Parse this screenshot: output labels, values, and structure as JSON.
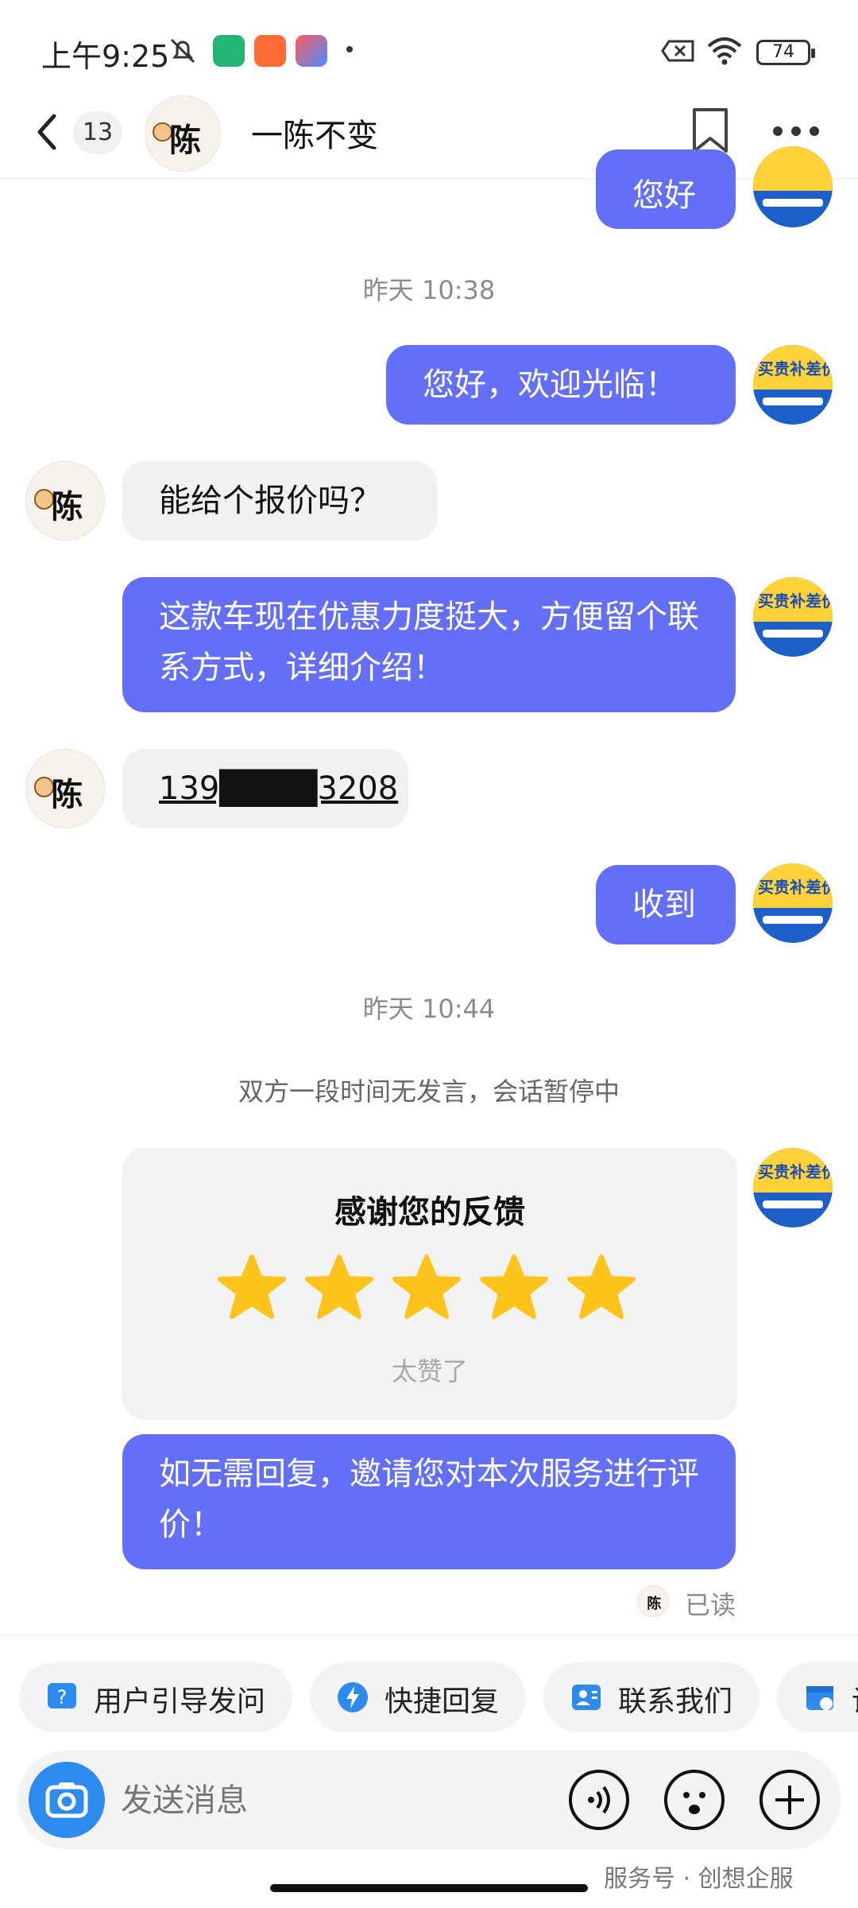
{
  "status_bar": {
    "time": "上午9:25",
    "battery": "74"
  },
  "header": {
    "unread_count": "13",
    "contact_name": "一陈不变",
    "contact_avatar_char": "陈"
  },
  "brand_avatar": {
    "text": "买贵补差价"
  },
  "messages": [
    {
      "side": "out",
      "text": "您好"
    },
    {
      "type": "timestamp",
      "text": "昨天 10:38"
    },
    {
      "side": "out",
      "text": "您好，欢迎光临！"
    },
    {
      "side": "in",
      "text": "能给个报价吗？"
    },
    {
      "side": "out",
      "text": "这款车现在优惠力度挺大，方便留个联系方式，详细介绍！"
    },
    {
      "side": "in",
      "text": "139████3208"
    },
    {
      "side": "out",
      "text": "收到"
    },
    {
      "type": "timestamp",
      "text": "昨天 10:44"
    },
    {
      "type": "system",
      "text": "双方一段时间无发言，会话暂停中"
    },
    {
      "side": "out",
      "text": "如无需回复，邀请您对本次服务进行评价！"
    }
  ],
  "rating_card": {
    "title": "感谢您的反馈",
    "rating": 5,
    "max": 5,
    "caption": "太赞了",
    "star_color": "#ffc41c"
  },
  "read_receipt": "已读",
  "quick_replies": [
    "用户引导发问",
    "快捷回复",
    "联系我们",
    "设"
  ],
  "input": {
    "placeholder": "发送消息"
  },
  "watermark": "服务号 · 创想企服",
  "colors": {
    "outgoing_bubble": "#636ff6",
    "incoming_bubble": "#f1f1f1",
    "accent_blue": "#2d8bf0"
  }
}
